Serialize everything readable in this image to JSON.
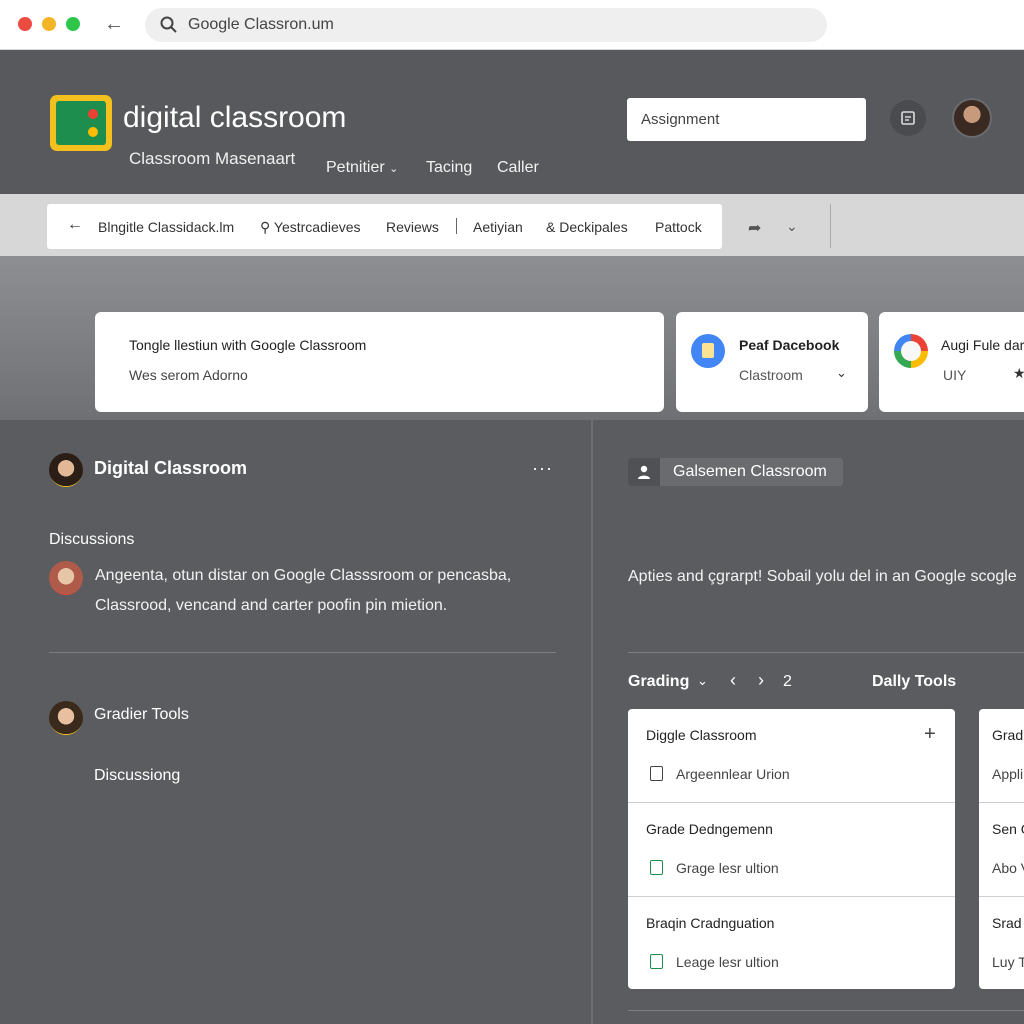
{
  "browser": {
    "url": "Google Classron.um"
  },
  "header": {
    "title": "digital classroom",
    "subtitle": "Classroom Masenaart",
    "nav": [
      {
        "label": "Petnitier"
      },
      {
        "label": "Tacing"
      },
      {
        "label": "Caller"
      }
    ],
    "search_value": "Assignment"
  },
  "toolbar": {
    "items": [
      {
        "label": "Blngitle Classidack.lm"
      },
      {
        "label": "Yestrcadieves"
      },
      {
        "label": "Reviews"
      },
      {
        "label": "Aetiyian"
      },
      {
        "label": "Deckipales"
      },
      {
        "label": "Pattock"
      }
    ]
  },
  "cards": {
    "main": {
      "line1": "Tongle llestiun with Google Classroom",
      "line2": "Wes serom Adorno"
    },
    "second": {
      "title": "Peaf Dacebook",
      "sub": "Clastroom"
    },
    "third": {
      "title": "Augi Fule dar",
      "sub": "UIY"
    }
  },
  "left": {
    "title": "Digital Classroom",
    "discussions_heading": "Discussions",
    "discussion_line1": "Angeenta, otun distar on Google Classsroom or pencasba,",
    "discussion_line2": "Classrood, vencand and carter poofin pin mietion.",
    "grader_tools": "Gradier Tools",
    "discussing": "Discussiong"
  },
  "right": {
    "chip": "Galsemen Classroom",
    "text": "Apties and çgrarpt! Sobail yolu del in an Google scogle",
    "grading": "Grading",
    "page": "2",
    "daily_tools": "Dally Tools",
    "grade_card": [
      {
        "title": "Diggle Classroom",
        "sub": "Argeennlear Urion"
      },
      {
        "title": "Grade Dedngemenn",
        "sub": "Grage lesr ultion"
      },
      {
        "title": "Braqin Cradnguation",
        "sub": "Leage lesr ultion"
      }
    ],
    "grade_card2": [
      {
        "title": "Grad",
        "sub": "Appli"
      },
      {
        "title": "Sen G",
        "sub": "Abo V"
      },
      {
        "title": "Srad",
        "sub": "Luy T"
      }
    ]
  }
}
